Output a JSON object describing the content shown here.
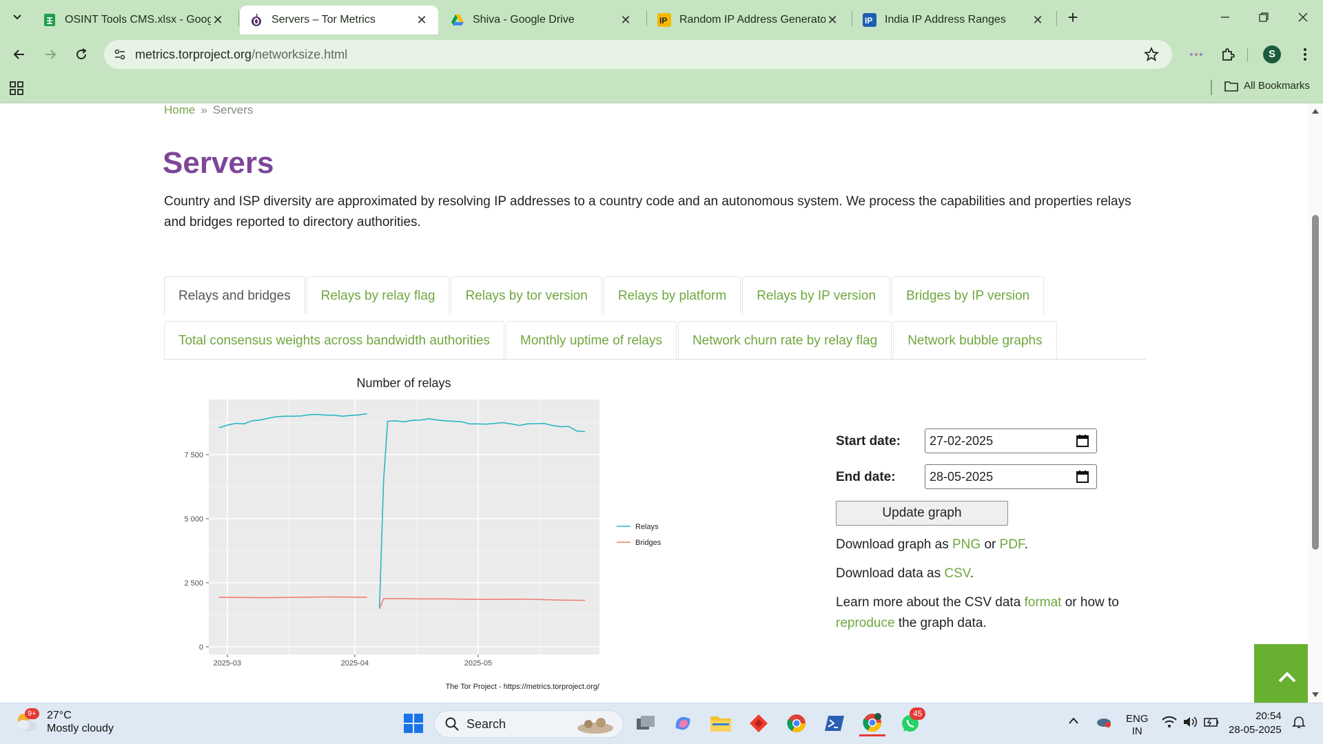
{
  "browser": {
    "tabs": [
      {
        "title": "OSINT Tools CMS.xlsx - Google",
        "favicon": "sheets-icon",
        "active": false
      },
      {
        "title": "Servers – Tor Metrics",
        "favicon": "tor-icon",
        "active": true
      },
      {
        "title": "Shiva - Google Drive",
        "favicon": "drive-icon",
        "active": false
      },
      {
        "title": "Random IP Address Generator,",
        "favicon": "ip-icon",
        "active": false
      },
      {
        "title": "India IP Address Ranges",
        "favicon": "ip-blue-icon",
        "active": false
      }
    ],
    "url_domain": "metrics.torproject.org",
    "url_path": "/networksize.html",
    "profile_initial": "S",
    "bookmarks_label": "All Bookmarks"
  },
  "page": {
    "breadcrumb": {
      "home": "Home",
      "separator": "»",
      "current": "Servers"
    },
    "title": "Servers",
    "intro": "Country and ISP diversity are approximated by resolving IP addresses to a country code and an autonomous system. We process the capabilities and properties relays and bridges reported to directory authorities.",
    "tabs_row1": [
      "Relays and bridges",
      "Relays by relay flag",
      "Relays by tor version",
      "Relays by platform",
      "Relays by IP version",
      "Bridges by IP version"
    ],
    "tabs_row2": [
      "Total consensus weights across bandwidth authorities",
      "Monthly uptime of relays",
      "Network churn rate by relay flag",
      "Network bubble graphs"
    ],
    "form": {
      "start_label": "Start date:",
      "start_value": "27-02-2025",
      "end_label": "End date:",
      "end_value": "28-05-2025",
      "update_button": "Update graph"
    },
    "download_graph": {
      "prefix": "Download graph as",
      "png": "PNG",
      "or": "or",
      "pdf": "PDF",
      "suffix": "."
    },
    "download_data": {
      "prefix": "Download data as",
      "csv": "CSV",
      "suffix": "."
    },
    "learn_more": {
      "prefix": "Learn more about the CSV data",
      "format": "format",
      "middle": "or how to",
      "reproduce": "reproduce",
      "suffix": "the graph data."
    }
  },
  "chart_data": {
    "type": "line",
    "title": "Number of relays",
    "xlabel": "",
    "ylabel": "",
    "x_ticks": [
      "2025-03",
      "2025-04",
      "2025-05"
    ],
    "y_ticks": [
      "0",
      "2 500",
      "5 000",
      "7 500"
    ],
    "ylim": [
      -300,
      9650
    ],
    "x_range": [
      "2025-02-27",
      "2025-05-28"
    ],
    "grid": true,
    "legend_position": "right",
    "caption": "The Tor Project - https://metrics.torproject.org/",
    "series": [
      {
        "name": "Relays",
        "color": "#29b6c4",
        "segments": [
          [
            [
              "2025-02-27",
              8550
            ],
            [
              "2025-03-01",
              8650
            ],
            [
              "2025-03-03",
              8720
            ],
            [
              "2025-03-05",
              8700
            ],
            [
              "2025-03-07",
              8820
            ],
            [
              "2025-03-09",
              8850
            ],
            [
              "2025-03-11",
              8920
            ],
            [
              "2025-03-13",
              8980
            ],
            [
              "2025-03-15",
              9000
            ],
            [
              "2025-03-17",
              9000
            ],
            [
              "2025-03-19",
              9010
            ],
            [
              "2025-03-21",
              9060
            ],
            [
              "2025-03-23",
              9070
            ],
            [
              "2025-03-25",
              9040
            ],
            [
              "2025-03-27",
              9040
            ],
            [
              "2025-03-29",
              9000
            ],
            [
              "2025-03-31",
              9030
            ],
            [
              "2025-04-02",
              9050
            ],
            [
              "2025-04-04",
              9100
            ]
          ],
          [
            [
              "2025-04-07",
              1500
            ],
            [
              "2025-04-08",
              6500
            ],
            [
              "2025-04-09",
              8800
            ],
            [
              "2025-04-11",
              8820
            ],
            [
              "2025-04-13",
              8780
            ],
            [
              "2025-04-15",
              8840
            ],
            [
              "2025-04-17",
              8850
            ],
            [
              "2025-04-19",
              8900
            ],
            [
              "2025-04-21",
              8850
            ],
            [
              "2025-04-23",
              8820
            ],
            [
              "2025-04-25",
              8800
            ],
            [
              "2025-04-27",
              8780
            ],
            [
              "2025-04-29",
              8700
            ],
            [
              "2025-05-01",
              8700
            ],
            [
              "2025-05-03",
              8690
            ],
            [
              "2025-05-05",
              8720
            ],
            [
              "2025-05-07",
              8750
            ],
            [
              "2025-05-09",
              8700
            ],
            [
              "2025-05-11",
              8640
            ],
            [
              "2025-05-13",
              8700
            ],
            [
              "2025-05-15",
              8710
            ],
            [
              "2025-05-17",
              8720
            ],
            [
              "2025-05-19",
              8640
            ],
            [
              "2025-05-21",
              8590
            ],
            [
              "2025-05-23",
              8600
            ],
            [
              "2025-05-25",
              8420
            ],
            [
              "2025-05-27",
              8400
            ]
          ]
        ]
      },
      {
        "name": "Bridges",
        "color": "#ef7f74",
        "segments": [
          [
            [
              "2025-02-27",
              1930
            ],
            [
              "2025-03-05",
              1925
            ],
            [
              "2025-03-10",
              1915
            ],
            [
              "2025-03-15",
              1925
            ],
            [
              "2025-03-20",
              1935
            ],
            [
              "2025-03-25",
              1945
            ],
            [
              "2025-03-30",
              1940
            ],
            [
              "2025-04-04",
              1930
            ]
          ],
          [
            [
              "2025-04-07",
              1480
            ],
            [
              "2025-04-08",
              1880
            ],
            [
              "2025-04-12",
              1880
            ],
            [
              "2025-04-17",
              1870
            ],
            [
              "2025-04-22",
              1870
            ],
            [
              "2025-04-27",
              1860
            ],
            [
              "2025-05-02",
              1850
            ],
            [
              "2025-05-07",
              1855
            ],
            [
              "2025-05-12",
              1860
            ],
            [
              "2025-05-17",
              1840
            ],
            [
              "2025-05-22",
              1820
            ],
            [
              "2025-05-27",
              1810
            ]
          ]
        ]
      }
    ]
  },
  "taskbar": {
    "weather_temp": "27°C",
    "weather_desc": "Mostly cloudy",
    "weather_badge": "9+",
    "search_label": "Search",
    "whatsapp_badge": "45",
    "lang_top": "ENG",
    "lang_bottom": "IN",
    "time": "20:54",
    "date": "28-05-2025"
  }
}
